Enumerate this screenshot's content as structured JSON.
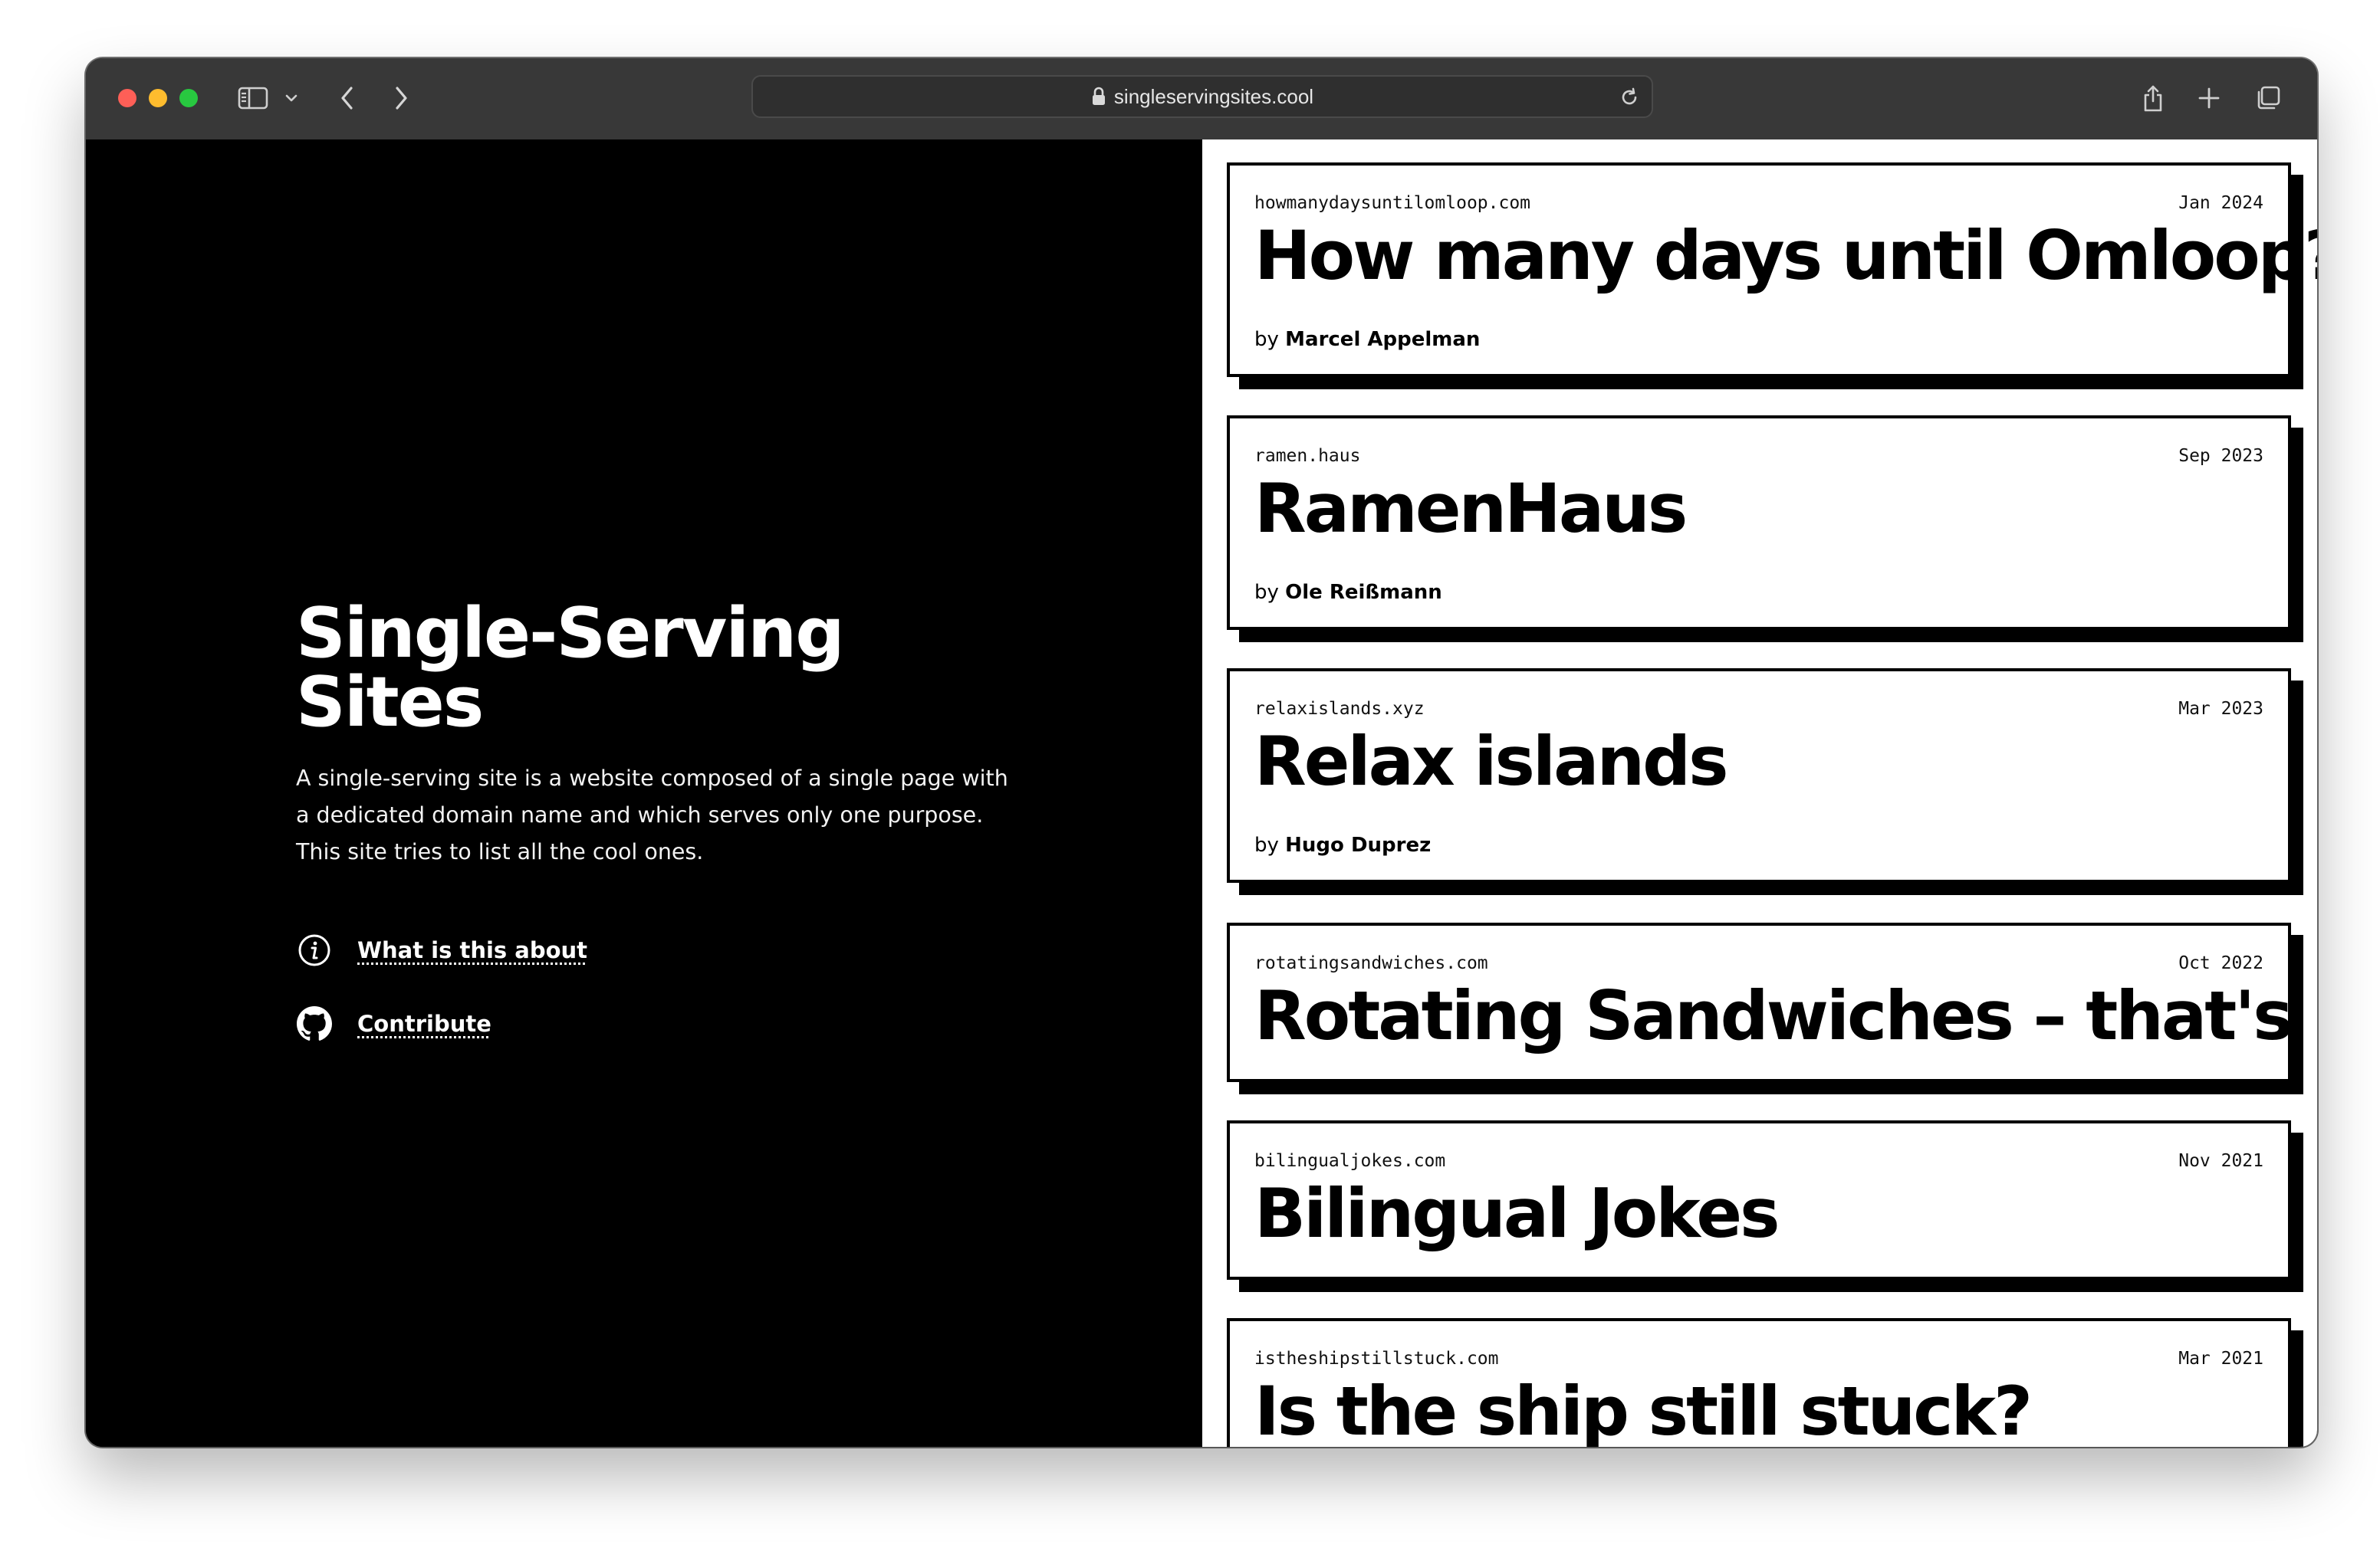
{
  "browser": {
    "url": "singleservingsites.cool",
    "icons": [
      "sidebar-icon",
      "chevron-down-icon",
      "back-icon",
      "forward-icon",
      "lock-icon",
      "reload-icon",
      "share-icon",
      "new-tab-icon",
      "tab-overview-icon"
    ]
  },
  "hero": {
    "title": "Single-Serving Sites",
    "description": "A single-serving site is a website composed of a single page with a dedicated domain name and which serves only one purpose. This site tries to list all the cool ones.",
    "links": [
      {
        "label": "What is this about",
        "icon": "info-icon"
      },
      {
        "label": "Contribute",
        "icon": "github-icon"
      }
    ]
  },
  "sites": [
    {
      "domain": "howmanydaysuntilomloop.com",
      "date": "Jan 2024",
      "title": "How many days until Omloop?",
      "by": "by",
      "author": "Marcel Appelman"
    },
    {
      "domain": "ramen.haus",
      "date": "Sep 2023",
      "title": "RamenHaus",
      "by": "by",
      "author": "Ole Reißmann"
    },
    {
      "domain": "relaxislands.xyz",
      "date": "Mar 2023",
      "title": "Relax islands",
      "by": "by",
      "author": "Hugo Duprez"
    },
    {
      "domain": "rotatingsandwiches.com",
      "date": "Oct 2022",
      "title": "Rotating Sandwiches – that's it"
    },
    {
      "domain": "bilingualjokes.com",
      "date": "Nov 2021",
      "title": "Bilingual Jokes"
    },
    {
      "domain": "istheshipstillstuck.com",
      "date": "Mar 2021",
      "title": "Is the ship still stuck?"
    }
  ],
  "colors": {
    "left_bg": "#000000",
    "right_bg": "#ffffff",
    "toolbar_bg": "#383838",
    "card_border": "#000000"
  }
}
